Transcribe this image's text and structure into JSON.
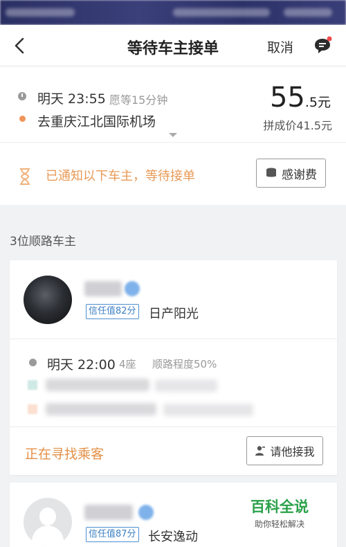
{
  "nav": {
    "title": "等待车主接单",
    "cancel_label": "取消"
  },
  "trip": {
    "time": "明天 23:55",
    "wait_note": "愿等15分钟",
    "destination": "去重庆江北国际机场",
    "price_int": "55",
    "price_dec": ".5元",
    "pool_price": "拼成价41.5元"
  },
  "notice": {
    "message": "已通知以下车主，等待接单",
    "thanks_button": "感谢费"
  },
  "drivers_count": "3位顺路车主",
  "drivers": [
    {
      "trust": "信任值82分",
      "car": "日产阳光",
      "time": "明天 22:00",
      "seats": "4座",
      "match": "顺路程度50%",
      "status": "正在寻找乘客",
      "action_label": "请他接我"
    },
    {
      "trust": "信任值87分",
      "car": "长安逸动"
    }
  ],
  "watermark": {
    "title": "百科全说",
    "subtitle": "助你轻松解决"
  },
  "colors": {
    "accent_orange": "#e39048",
    "trust_blue": "#3b7fc4",
    "watermark_green": "#2aa14a"
  }
}
